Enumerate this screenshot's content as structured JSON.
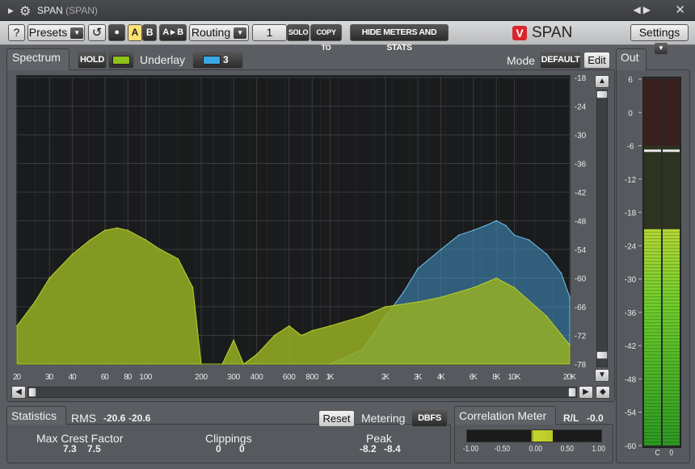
{
  "window": {
    "title": "SPAN",
    "subtitle": "(SPAN)"
  },
  "toolbar": {
    "help": "?",
    "presets": "Presets",
    "a": "A",
    "b": "B",
    "a_to_b": "A ▸ B",
    "routing": "Routing",
    "group_num": "1",
    "solo": "SOLO",
    "copy_to": "COPY TO",
    "hide_meters": "HIDE METERS AND STATS",
    "brand": "SPAN",
    "settings": "Settings"
  },
  "spectrum": {
    "label": "Spectrum",
    "hold": "HOLD",
    "underlay_label": "Underlay",
    "underlay_value": "3",
    "mode_label": "Mode",
    "mode_value": "DEFAULT",
    "edit": "Edit",
    "colors": {
      "primary": "#9cb427",
      "underlay": "#3ea2d8",
      "background": "#1a1b1c"
    }
  },
  "chart_data": {
    "type": "area",
    "x_ticks": [
      "20",
      "30",
      "40",
      "60",
      "80",
      "100",
      "200",
      "300",
      "400",
      "600",
      "800",
      "1K",
      "2K",
      "3K",
      "4K",
      "6K",
      "8K",
      "10K",
      "20K"
    ],
    "y_ticks": [
      "-18",
      "-24",
      "-30",
      "-36",
      "-42",
      "-48",
      "-54",
      "-60",
      "-66",
      "-72",
      "-78"
    ],
    "xlim": [
      20,
      20000
    ],
    "ylim": [
      -78,
      -18
    ],
    "x_scale": "log",
    "grid": true,
    "series": [
      {
        "x": [
          20,
          25,
          30,
          40,
          50,
          60,
          70,
          80,
          100,
          120,
          150,
          180,
          200,
          260,
          300,
          340,
          400,
          500,
          600,
          700,
          800,
          1000,
          1500,
          2000,
          3000,
          4000,
          6000,
          8000,
          10000,
          15000,
          20000
        ],
        "y": [
          -70,
          -65,
          -60,
          -55,
          -52,
          -50,
          -49.5,
          -50,
          -52,
          -54,
          -56,
          -62,
          -78,
          -78,
          -73,
          -78,
          -76,
          -72,
          -70,
          -72,
          -71,
          -70,
          -68,
          -66,
          -65,
          -64,
          -62,
          -60,
          -62,
          -68,
          -74
        ]
      },
      {
        "x": [
          1000,
          1500,
          2000,
          2500,
          3000,
          4000,
          5000,
          6000,
          7000,
          8000,
          9000,
          10000,
          12000,
          15000,
          18000,
          20000
        ],
        "y": [
          -78,
          -75,
          -68,
          -63,
          -58,
          -54,
          -51,
          -50,
          -49,
          -48,
          -49,
          -51,
          -52,
          -55,
          -59,
          -64
        ]
      }
    ]
  },
  "scroll": {
    "v_up": "▲",
    "v_down": "▼",
    "h_left": "◀",
    "h_right": "▶",
    "diamond": "◆"
  },
  "out": {
    "label": "Out",
    "scale": [
      "6",
      "0",
      "-6",
      "-12",
      "-18",
      "-24",
      "-30",
      "-36",
      "-42",
      "-48",
      "-54",
      "-60"
    ],
    "ch_labels": [
      "C",
      "0"
    ],
    "level": [
      -21,
      -21
    ],
    "peak": [
      -6.9,
      -6.9
    ]
  },
  "statistics": {
    "label": "Statistics",
    "rms_label": "RMS",
    "rms_l": "-20.6",
    "rms_r": "-20.6",
    "reset": "Reset",
    "metering_label": "Metering",
    "metering_value": "DBFS",
    "crest_label": "Max Crest Factor",
    "crest_l": "7.3",
    "crest_r": "7.5",
    "clip_label": "Clippings",
    "clip_l": "0",
    "clip_r": "0",
    "peak_label": "Peak",
    "peak_l": "-8.2",
    "peak_r": "-8.4"
  },
  "correlation": {
    "label": "Correlation Meter",
    "mode": "R/L",
    "value": "-0.0",
    "scale": [
      "-1.00",
      "-0.50",
      "0.00",
      "0.50",
      "1.00"
    ]
  }
}
